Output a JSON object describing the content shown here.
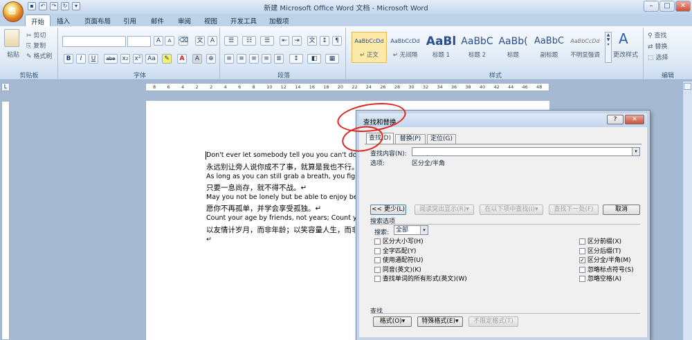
{
  "window": {
    "title": "新建 Microsoft Office Word 文档 - Microsoft Word"
  },
  "tabs": [
    "开始",
    "插入",
    "页面布局",
    "引用",
    "邮件",
    "审阅",
    "视图",
    "开发工具",
    "加载项"
  ],
  "ribbon": {
    "clipboard": {
      "paste": "粘贴",
      "cut": "剪切",
      "copy": "复制",
      "format_painter": "格式刷",
      "label": "剪贴板"
    },
    "font": {
      "label": "字体",
      "grow": "A",
      "shrink": "A",
      "bold": "B",
      "italic": "I",
      "underline": "U",
      "strike": "abe",
      "sub": "x₂",
      "sup": "x²",
      "case": "Aa",
      "color": "A"
    },
    "paragraph": {
      "label": "段落"
    },
    "styles": {
      "label": "样式",
      "items": [
        {
          "preview": "AaBbCcDd",
          "name": "↵ 正文"
        },
        {
          "preview": "AaBbCcDd",
          "name": "↵ 无间隔"
        },
        {
          "preview": "AaBl",
          "name": "标题 1"
        },
        {
          "preview": "AaBbC",
          "name": "标题 2"
        },
        {
          "preview": "AaBb(",
          "name": "标题"
        },
        {
          "preview": "AaBbC",
          "name": "副标题"
        },
        {
          "preview": "AaBbCcDd",
          "name": "不明显强调"
        }
      ],
      "change": "更改样式"
    },
    "editing": {
      "label": "编辑",
      "find": "查找",
      "replace": "替换",
      "select": "选择"
    }
  },
  "ruler": [
    "8",
    "6",
    "4",
    "2",
    "2",
    "4",
    "6",
    "8",
    "10",
    "12",
    "14",
    "16",
    "18",
    "20",
    "22",
    "24",
    "26",
    "28",
    "30",
    "32",
    "34",
    "36",
    "38",
    "40",
    "42",
    "44",
    "46",
    "48"
  ],
  "document": {
    "lines": [
      "Don't ever let somebody tell you you can't do somet",
      "永远别让旁人说你成不了事，就算是我也不行。↵",
      "As long as you can still grab a breath, you fight. ↵",
      "只要一息尚存，就不得不战。↵",
      "May you not be lonely but be able to enjoy being alo",
      "愿你不再孤单，并学会享受孤独。↵",
      "Count your age by friends, not years; Count your life",
      "以友情计岁月，而非年龄；以笑容量人生，而非",
      "↵"
    ]
  },
  "dialog": {
    "title": "查找和替换",
    "help": "?",
    "close": "✕",
    "tabs": [
      "查找(D)",
      "替换(P)",
      "定位(G)"
    ],
    "find_label": "查找内容(N):",
    "find_value": "",
    "options_label": "选项:",
    "options_value": "区分全/半角",
    "buttons": {
      "less": "<< 更少(L)",
      "reading_highlight": "阅读突出显示(R)▾",
      "find_in": "在以下项中查找(I)▾",
      "find_next": "查找下一处(F)",
      "cancel": "取消"
    },
    "search_options_title": "搜索选项",
    "search_label": "搜索:",
    "search_value": "全部",
    "left_checks": [
      {
        "label": "区分大小写(H)",
        "checked": false
      },
      {
        "label": "全字匹配(Y)",
        "checked": false
      },
      {
        "label": "使用通配符(U)",
        "checked": false
      },
      {
        "label": "同音(英文)(K)",
        "checked": false
      },
      {
        "label": "查找单词的所有形式(英文)(W)",
        "checked": false
      }
    ],
    "right_checks": [
      {
        "label": "区分前缀(X)",
        "checked": false
      },
      {
        "label": "区分后缀(T)",
        "checked": false
      },
      {
        "label": "区分全/半角(M)",
        "checked": true
      },
      {
        "label": "忽略标点符号(S)",
        "checked": false
      },
      {
        "label": "忽略空格(A)",
        "checked": false
      }
    ],
    "find_section": "查找",
    "bottom_buttons": [
      "格式(O)▾",
      "特殊格式(E)▾",
      "不限定格式(T)"
    ]
  },
  "colors": {
    "accent": "#e0231f",
    "ribbon": "#dde8f5",
    "title": "#c5d7ee"
  }
}
